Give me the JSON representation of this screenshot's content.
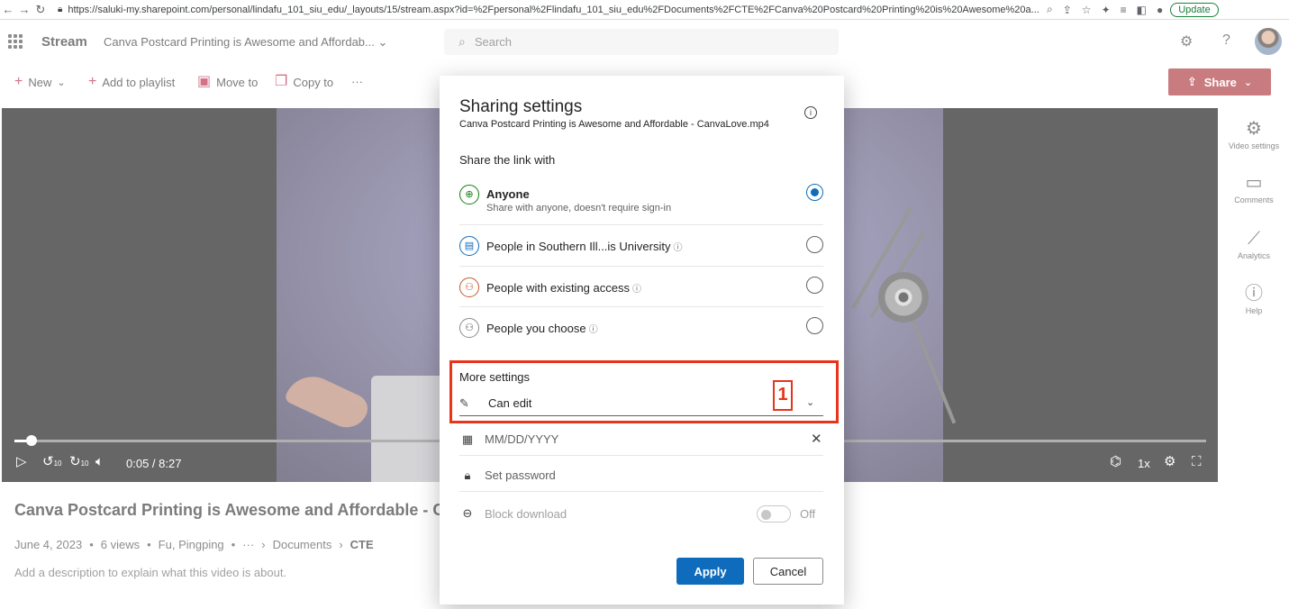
{
  "browser": {
    "url": "https://saluki-my.sharepoint.com/personal/lindafu_101_siu_edu/_layouts/15/stream.aspx?id=%2Fpersonal%2Flindafu_101_siu_edu%2FDocuments%2FCTE%2FCanva%20Postcard%20Printing%20is%20Awesome%20a...",
    "update_label": "Update"
  },
  "header": {
    "brand": "Stream",
    "doc_title": "Canva Postcard Printing is Awesome and Affordab...",
    "search_placeholder": "Search"
  },
  "commandbar": {
    "new_label": "New",
    "add_playlist_label": "Add to playlist",
    "move_label": "Move to",
    "copy_label": "Copy to",
    "more_label": "···",
    "share_label": "Share"
  },
  "player": {
    "time": "0:05 / 8:27",
    "rate": "1x",
    "progress_fraction": 0.01,
    "skip_back_label": "10",
    "skip_fwd_label": "10"
  },
  "rail": {
    "video_settings": "Video settings",
    "comments": "Comments",
    "analytics": "Analytics",
    "help": "Help"
  },
  "video": {
    "title": "Canva Postcard Printing is Awesome and Affordable - Canva",
    "date": "June 4, 2023",
    "views": "6 views",
    "owner": "Fu, Pingping",
    "ellipsis": "···",
    "crumb1": "Documents",
    "crumb2": "CTE",
    "description": "Add a description to explain what this video is about."
  },
  "dialog": {
    "title": "Sharing settings",
    "subtitle": "Canva Postcard Printing is Awesome and Affordable - CanvaLove.mp4",
    "share_with_label": "Share the link with",
    "options": [
      {
        "label": "Anyone",
        "desc": "Share with anyone, doesn't require sign-in",
        "selected": true
      },
      {
        "label": "People in Southern Ill...is University",
        "selected": false
      },
      {
        "label": "People with existing access",
        "selected": false
      },
      {
        "label": "People you choose",
        "selected": false
      }
    ],
    "more_settings_label": "More settings",
    "permission": "Can edit",
    "expiry_placeholder": "MM/DD/YYYY",
    "password_placeholder": "Set password",
    "block_download_label": "Block download",
    "block_download_state": "Off",
    "apply_label": "Apply",
    "cancel_label": "Cancel"
  },
  "annotation": {
    "step_number": "1",
    "color": "#e8341b"
  },
  "colors": {
    "brand_red": "#a4262c",
    "accent_blue": "#0f6cbd",
    "command_icon": "#b4173a"
  }
}
